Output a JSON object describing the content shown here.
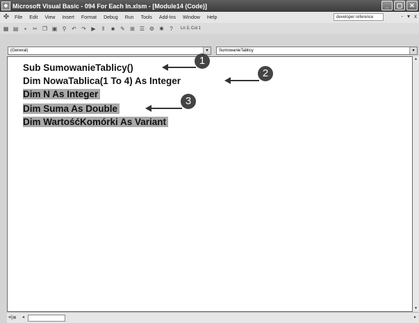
{
  "window": {
    "title": "Microsoft Visual Basic - 094 For Each In.xlsm - [Module14 (Code)]",
    "controls": [
      "_",
      "▢",
      "✕"
    ]
  },
  "menu": {
    "items": [
      "File",
      "Edit",
      "View",
      "Insert",
      "Format",
      "Debug",
      "Run",
      "Tools",
      "Add-Ins",
      "Window",
      "Help"
    ],
    "help_search_value": "developer reference",
    "doc_controls": [
      "-",
      "▾",
      "x"
    ]
  },
  "toolbar": {
    "status": "Ln 3, Col 1"
  },
  "dropdowns": {
    "object_value": "(General)",
    "procedure_value": "SumowanieTablicy"
  },
  "code": {
    "lines": [
      "Sub SumowanieTablicy()",
      "Dim NowaTablica(1 To 4) As Integer",
      "Dim N As Integer",
      "Dim Suma As Double",
      "Dim WartośćKomórki As Variant"
    ]
  },
  "callouts": [
    "1",
    "2",
    "3"
  ]
}
